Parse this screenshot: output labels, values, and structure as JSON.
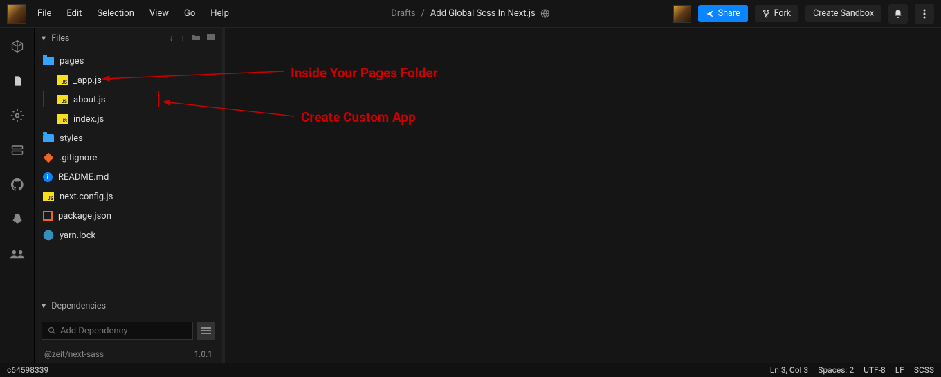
{
  "menu": [
    "File",
    "Edit",
    "Selection",
    "View",
    "Go",
    "Help"
  ],
  "breadcrumbs": {
    "root": "Drafts",
    "title": "Add Global Scss In Next.js"
  },
  "buttons": {
    "share": "Share",
    "fork": "Fork",
    "create": "Create Sandbox"
  },
  "sidebar": {
    "files_label": "Files",
    "tree": {
      "pages": "pages",
      "app": "_app.js",
      "about": "about.js",
      "index": "index.js",
      "styles": "styles",
      "gitignore": ".gitignore",
      "readme": "README.md",
      "nextconfig": "next.config.js",
      "packagejson": "package.json",
      "yarnlock": "yarn.lock"
    },
    "deps_label": "Dependencies",
    "add_dep_placeholder": "Add Dependency",
    "deps": [
      {
        "name": "@zeit/next-sass",
        "version": "1.0.1"
      }
    ]
  },
  "annotations": {
    "a1": "Inside Your Pages Folder",
    "a2": "Create Custom App"
  },
  "status": {
    "hash": "c64598339",
    "pos": "Ln 3, Col 3",
    "spaces": "Spaces: 2",
    "enc": "UTF-8",
    "eol": "LF",
    "lang": "SCSS"
  }
}
